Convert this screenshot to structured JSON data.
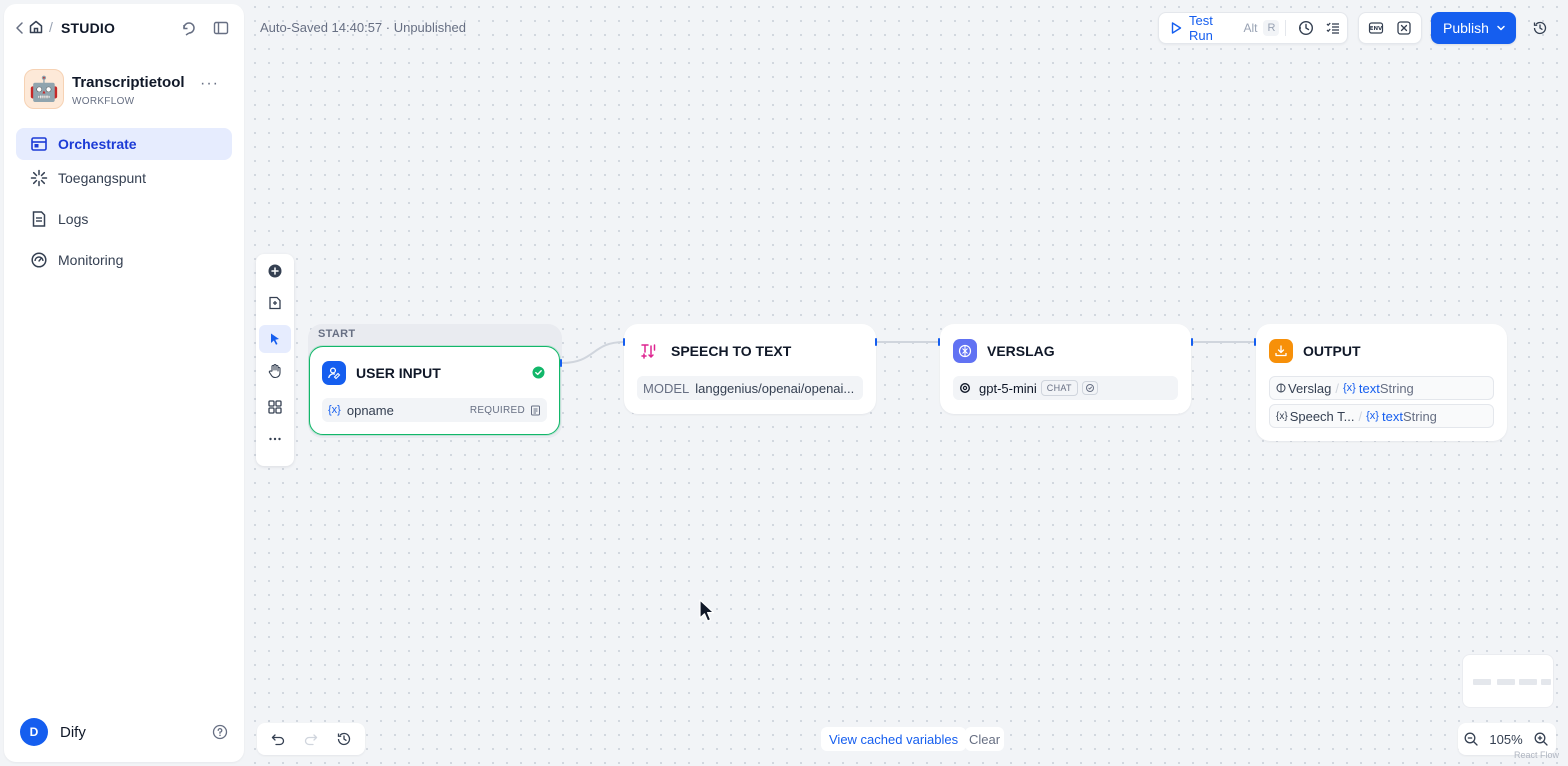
{
  "breadcrumb": {
    "studio": "STUDIO"
  },
  "app": {
    "name": "Transcriptietool",
    "type": "WORKFLOW",
    "avatar": "🤖",
    "more": "···"
  },
  "nav": [
    {
      "label": "Orchestrate",
      "icon": "orchestrate-icon",
      "active": true
    },
    {
      "label": "Toegangspunt",
      "icon": "access-point-icon",
      "active": false
    },
    {
      "label": "Logs",
      "icon": "logs-icon",
      "active": false
    },
    {
      "label": "Monitoring",
      "icon": "monitoring-icon",
      "active": false
    }
  ],
  "user": {
    "initial": "D",
    "name": "Dify"
  },
  "status": "Auto-Saved 14:40:57 · Unpublished",
  "toolbar": {
    "test_run": "Test Run",
    "shortcut_alt": "Alt",
    "shortcut_key": "R",
    "publish": "Publish"
  },
  "nodes": {
    "start": {
      "group_label": "START",
      "title": "USER INPUT",
      "var_icon": "{x}",
      "variable": "opname",
      "required": "REQUIRED"
    },
    "speech": {
      "title": "SPEECH TO TEXT",
      "model_label": "MODEL",
      "model_value": "langgenius/openai/openai..."
    },
    "verslag": {
      "title": "VERSLAG",
      "model": "gpt-5-mini",
      "mode_tag": "CHAT"
    },
    "output": {
      "title": "OUTPUT",
      "rows": [
        {
          "source": "Verslag",
          "var_icon": "{x}",
          "var": "text",
          "type": "String"
        },
        {
          "source": "Speech T...",
          "var_icon": "{x}",
          "var": "text",
          "type": "String"
        }
      ]
    }
  },
  "bottom": {
    "view_cache": "View cached variables",
    "clear": "Clear",
    "zoom": "105%",
    "attribution": "React Flow"
  },
  "colors": {
    "accent": "#155eef",
    "selected_border": "#12b76a",
    "start_icon": "#155eef",
    "speech_icon": "#dd2590",
    "llm_icon": "#6172f3",
    "output_icon": "#f79009"
  }
}
